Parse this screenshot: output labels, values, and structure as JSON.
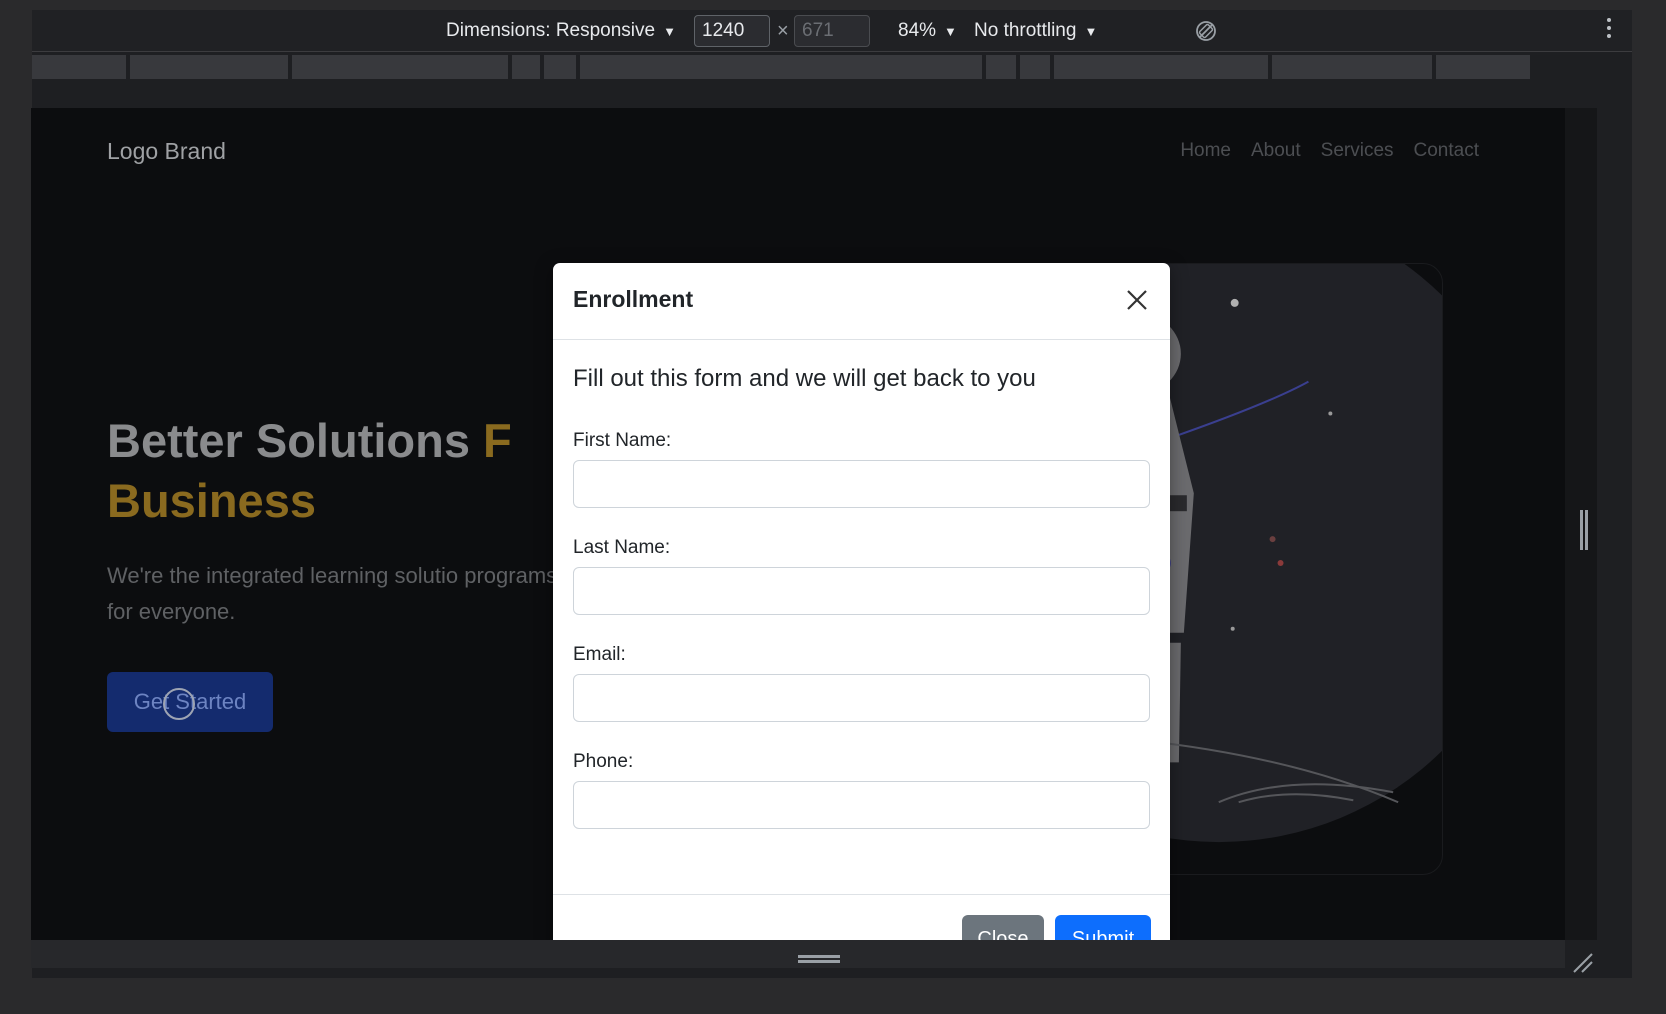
{
  "devtools": {
    "dimensions_label": "Dimensions: Responsive",
    "width_value": "1240",
    "height_value": "671",
    "times": "×",
    "zoom": "84%",
    "throttling": "No throttling"
  },
  "page": {
    "logo": "Logo Brand",
    "nav": [
      "Home",
      "About",
      "Services",
      "Contact"
    ],
    "hero_title_line1": "Better Solutions ",
    "hero_title_accent_partial": "F",
    "hero_title_line2": "Business",
    "hero_text": "We're the integrated learning solutio programs for everyone.",
    "cta_label": "Get Started"
  },
  "modal": {
    "title": "Enrollment",
    "lead": "Fill out this form and we will get back to you",
    "fields": [
      {
        "label": "First Name:",
        "value": ""
      },
      {
        "label": "Last Name:",
        "value": ""
      },
      {
        "label": "Email:",
        "value": ""
      },
      {
        "label": "Phone:",
        "value": ""
      }
    ],
    "close_label": "Close",
    "submit_label": "Submit"
  },
  "colors": {
    "primary": "#0d6efd",
    "secondary": "#6c757d",
    "accent_gold": "#8a6a1f"
  }
}
